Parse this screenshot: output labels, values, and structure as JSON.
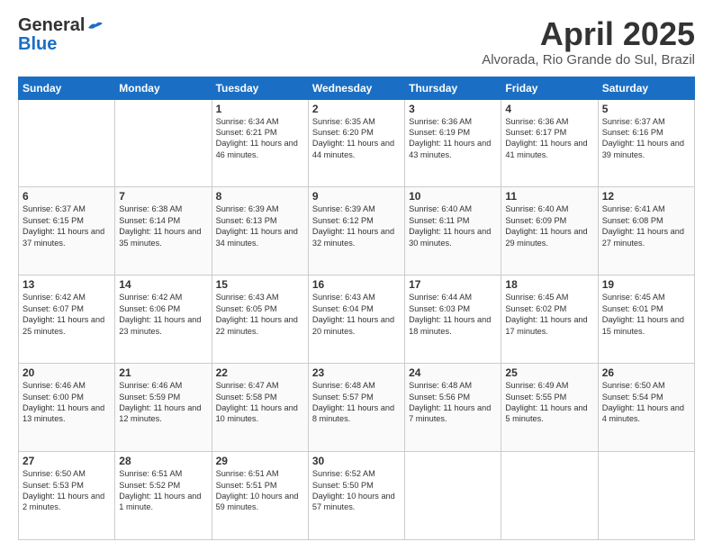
{
  "header": {
    "logo_general": "General",
    "logo_blue": "Blue",
    "title": "April 2025",
    "location": "Alvorada, Rio Grande do Sul, Brazil"
  },
  "days_of_week": [
    "Sunday",
    "Monday",
    "Tuesday",
    "Wednesday",
    "Thursday",
    "Friday",
    "Saturday"
  ],
  "weeks": [
    [
      {
        "day": "",
        "content": ""
      },
      {
        "day": "",
        "content": ""
      },
      {
        "day": "1",
        "content": "Sunrise: 6:34 AM\nSunset: 6:21 PM\nDaylight: 11 hours and 46 minutes."
      },
      {
        "day": "2",
        "content": "Sunrise: 6:35 AM\nSunset: 6:20 PM\nDaylight: 11 hours and 44 minutes."
      },
      {
        "day": "3",
        "content": "Sunrise: 6:36 AM\nSunset: 6:19 PM\nDaylight: 11 hours and 43 minutes."
      },
      {
        "day": "4",
        "content": "Sunrise: 6:36 AM\nSunset: 6:17 PM\nDaylight: 11 hours and 41 minutes."
      },
      {
        "day": "5",
        "content": "Sunrise: 6:37 AM\nSunset: 6:16 PM\nDaylight: 11 hours and 39 minutes."
      }
    ],
    [
      {
        "day": "6",
        "content": "Sunrise: 6:37 AM\nSunset: 6:15 PM\nDaylight: 11 hours and 37 minutes."
      },
      {
        "day": "7",
        "content": "Sunrise: 6:38 AM\nSunset: 6:14 PM\nDaylight: 11 hours and 35 minutes."
      },
      {
        "day": "8",
        "content": "Sunrise: 6:39 AM\nSunset: 6:13 PM\nDaylight: 11 hours and 34 minutes."
      },
      {
        "day": "9",
        "content": "Sunrise: 6:39 AM\nSunset: 6:12 PM\nDaylight: 11 hours and 32 minutes."
      },
      {
        "day": "10",
        "content": "Sunrise: 6:40 AM\nSunset: 6:11 PM\nDaylight: 11 hours and 30 minutes."
      },
      {
        "day": "11",
        "content": "Sunrise: 6:40 AM\nSunset: 6:09 PM\nDaylight: 11 hours and 29 minutes."
      },
      {
        "day": "12",
        "content": "Sunrise: 6:41 AM\nSunset: 6:08 PM\nDaylight: 11 hours and 27 minutes."
      }
    ],
    [
      {
        "day": "13",
        "content": "Sunrise: 6:42 AM\nSunset: 6:07 PM\nDaylight: 11 hours and 25 minutes."
      },
      {
        "day": "14",
        "content": "Sunrise: 6:42 AM\nSunset: 6:06 PM\nDaylight: 11 hours and 23 minutes."
      },
      {
        "day": "15",
        "content": "Sunrise: 6:43 AM\nSunset: 6:05 PM\nDaylight: 11 hours and 22 minutes."
      },
      {
        "day": "16",
        "content": "Sunrise: 6:43 AM\nSunset: 6:04 PM\nDaylight: 11 hours and 20 minutes."
      },
      {
        "day": "17",
        "content": "Sunrise: 6:44 AM\nSunset: 6:03 PM\nDaylight: 11 hours and 18 minutes."
      },
      {
        "day": "18",
        "content": "Sunrise: 6:45 AM\nSunset: 6:02 PM\nDaylight: 11 hours and 17 minutes."
      },
      {
        "day": "19",
        "content": "Sunrise: 6:45 AM\nSunset: 6:01 PM\nDaylight: 11 hours and 15 minutes."
      }
    ],
    [
      {
        "day": "20",
        "content": "Sunrise: 6:46 AM\nSunset: 6:00 PM\nDaylight: 11 hours and 13 minutes."
      },
      {
        "day": "21",
        "content": "Sunrise: 6:46 AM\nSunset: 5:59 PM\nDaylight: 11 hours and 12 minutes."
      },
      {
        "day": "22",
        "content": "Sunrise: 6:47 AM\nSunset: 5:58 PM\nDaylight: 11 hours and 10 minutes."
      },
      {
        "day": "23",
        "content": "Sunrise: 6:48 AM\nSunset: 5:57 PM\nDaylight: 11 hours and 8 minutes."
      },
      {
        "day": "24",
        "content": "Sunrise: 6:48 AM\nSunset: 5:56 PM\nDaylight: 11 hours and 7 minutes."
      },
      {
        "day": "25",
        "content": "Sunrise: 6:49 AM\nSunset: 5:55 PM\nDaylight: 11 hours and 5 minutes."
      },
      {
        "day": "26",
        "content": "Sunrise: 6:50 AM\nSunset: 5:54 PM\nDaylight: 11 hours and 4 minutes."
      }
    ],
    [
      {
        "day": "27",
        "content": "Sunrise: 6:50 AM\nSunset: 5:53 PM\nDaylight: 11 hours and 2 minutes."
      },
      {
        "day": "28",
        "content": "Sunrise: 6:51 AM\nSunset: 5:52 PM\nDaylight: 11 hours and 1 minute."
      },
      {
        "day": "29",
        "content": "Sunrise: 6:51 AM\nSunset: 5:51 PM\nDaylight: 10 hours and 59 minutes."
      },
      {
        "day": "30",
        "content": "Sunrise: 6:52 AM\nSunset: 5:50 PM\nDaylight: 10 hours and 57 minutes."
      },
      {
        "day": "",
        "content": ""
      },
      {
        "day": "",
        "content": ""
      },
      {
        "day": "",
        "content": ""
      }
    ]
  ]
}
